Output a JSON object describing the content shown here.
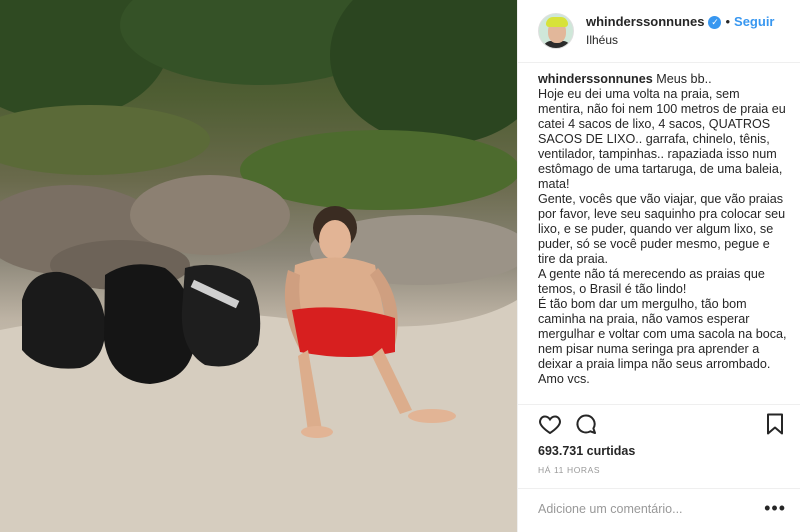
{
  "post": {
    "author": {
      "username": "whinderssonnunes",
      "verified_icon": "verified-badge-icon",
      "follow_label": "Seguir",
      "separator": "•",
      "location": "Ilhéus"
    },
    "caption": {
      "username": "whinderssonnunes",
      "paragraphs": [
        "Meus bb..",
        "Hoje eu dei uma volta na praia, sem mentira, não foi nem 100 metros de praia eu catei 4 sacos de lixo, 4 sacos, QUATROS SACOS DE LIXO.. garrafa, chinelo, tênis, ventilador, tampinhas.. rapaziada isso num estômago de uma tartaruga, de uma baleia, mata!",
        "Gente, vocês que vão viajar, que vão praias por favor, leve seu saquinho pra colocar seu lixo, e se puder, quando ver algum lixo, se puder, só se você puder mesmo, pegue e tire da praia.",
        "A gente não tá merecendo as praias que temos, o Brasil é tão lindo!",
        "É tão bom dar um mergulho, tão bom caminha na praia, não vamos esperar mergulhar e voltar com uma sacola na boca, nem pisar numa seringa pra aprender a deixar a praia limpa não seus arrombado. Amo vcs."
      ]
    },
    "actions": {
      "like_icon": "heart-icon",
      "comment_icon": "comment-bubble-icon",
      "save_icon": "bookmark-icon"
    },
    "likes": "693.731 curtidas",
    "timestamp": "HÁ 11 HORAS",
    "comment_placeholder": "Adicione um comentário...",
    "more_label": "•••"
  },
  "colors": {
    "accent": "#3897f0",
    "text": "#262626",
    "muted": "#999999",
    "border": "#efefef"
  }
}
